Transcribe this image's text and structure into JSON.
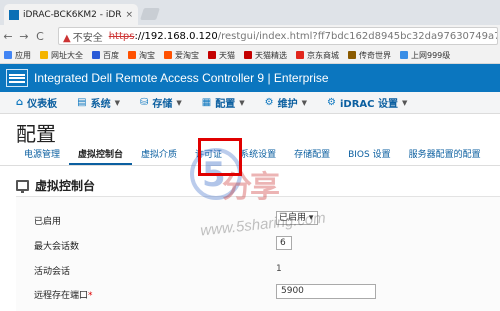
{
  "browser": {
    "tab_title": "iDRAC-BCK6KM2 - iDR",
    "tab_close": "×",
    "back": "←",
    "forward": "→",
    "reload": "C",
    "security_label": "不安全",
    "url_proto": "https",
    "url_host": "://192.168.0.120",
    "url_path": "/restgui/index.html?ff7bdc162d8945bc32da97630749a793#/"
  },
  "bookmarks": [
    {
      "label": "应用",
      "color": "#4285f4"
    },
    {
      "label": "网址大全",
      "color": "#f4b400"
    },
    {
      "label": "百度",
      "color": "#2a5bd7"
    },
    {
      "label": "淘宝",
      "color": "#ff5000"
    },
    {
      "label": "爱淘宝",
      "color": "#ff5000"
    },
    {
      "label": "天猫",
      "color": "#c40000"
    },
    {
      "label": "天猫精选",
      "color": "#c40000"
    },
    {
      "label": "京东商城",
      "color": "#e1251b"
    },
    {
      "label": "传奇世界",
      "color": "#8a5a00"
    },
    {
      "label": "上网999级",
      "color": "#3a8ee6"
    }
  ],
  "idrac": {
    "title": "Integrated Dell Remote Access Controller 9 | Enterprise",
    "brand_color": "#0b76bf"
  },
  "menu": [
    {
      "label": "仪表板",
      "icon": "home-icon",
      "glyph": "⌂",
      "has_dropdown": false
    },
    {
      "label": "系统",
      "icon": "system-icon",
      "glyph": "▤",
      "has_dropdown": true
    },
    {
      "label": "存储",
      "icon": "storage-icon",
      "glyph": "⛁",
      "has_dropdown": true
    },
    {
      "label": "配置",
      "icon": "config-icon",
      "glyph": "▦",
      "has_dropdown": true
    },
    {
      "label": "维护",
      "icon": "maintenance-icon",
      "glyph": "⚙",
      "has_dropdown": true
    },
    {
      "label": "iDRAC 设置",
      "icon": "idrac-settings-icon",
      "glyph": "⚙",
      "has_dropdown": true
    }
  ],
  "page": {
    "title": "配置",
    "subtabs": [
      "电源管理",
      "虚拟控制台",
      "虚拟介质",
      "许可证",
      "系统设置",
      "存储配置",
      "BIOS 设置",
      "服务器配置的配置"
    ],
    "active_subtab": "虚拟控制台",
    "section_title": "虚拟控制台"
  },
  "form": {
    "enabled_label": "已启用",
    "enabled_value": "已启用",
    "max_sessions_label": "最大会话数",
    "max_sessions_value": "6",
    "active_sessions_label": "活动会话",
    "active_sessions_value": "1",
    "remote_port_label": "远程存在端口",
    "remote_port_required": "*",
    "remote_port_value": "5900"
  },
  "watermark": {
    "text": "分享",
    "url": "www.5sharing.com"
  },
  "highlight_color": "#e00000"
}
